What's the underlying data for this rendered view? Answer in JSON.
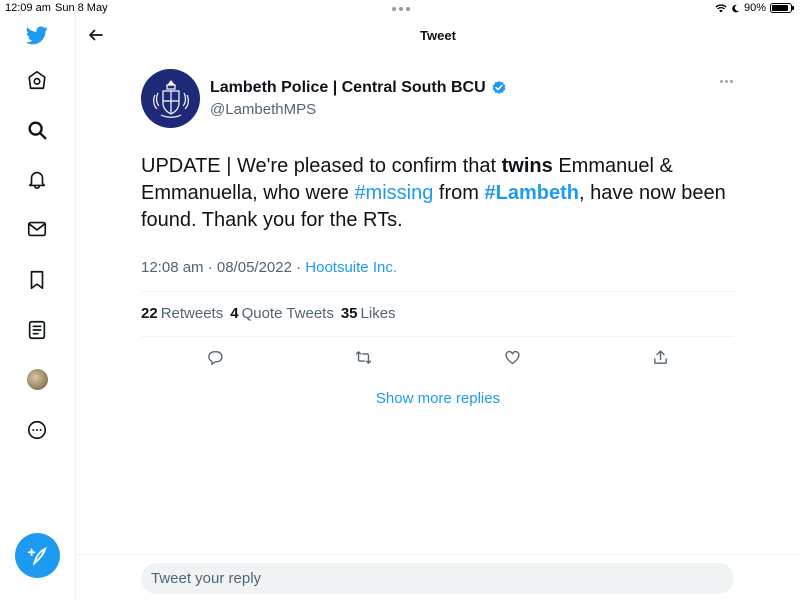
{
  "status_bar": {
    "time": "12:09 am",
    "date": "Sun 8 May",
    "battery": "90%",
    "battery_level": 0.9
  },
  "sidebar": {
    "items": [
      {
        "icon": "twitter-logo-icon"
      },
      {
        "icon": "home-icon"
      },
      {
        "icon": "search-icon"
      },
      {
        "icon": "notifications-icon"
      },
      {
        "icon": "messages-icon"
      },
      {
        "icon": "bookmarks-icon"
      },
      {
        "icon": "lists-icon"
      },
      {
        "icon": "profile-avatar"
      },
      {
        "icon": "more-icon"
      }
    ],
    "compose_icon": "compose-tweet-icon",
    "accent": "#1d9bf0"
  },
  "header": {
    "title": "Tweet"
  },
  "tweet": {
    "author_name": "Lambeth Police | Central South BCU",
    "handle": "@LambethMPS",
    "verified": true,
    "text_parts": {
      "p1": "UPDATE | We're pleased to confirm that ",
      "p2": "twins",
      "p3": " Emmanuel & Emmanuella, who were ",
      "p4": "#missing",
      "p5": " from ",
      "p6": "#Lambeth",
      "p7": ", have now been found. Thank you for the RTs."
    },
    "timestamp": "12:08 am · 08/05/2022 · ",
    "source": "Hootsuite Inc.",
    "stats": {
      "retweets_count": "22",
      "retweets_label": "Retweets",
      "quote_count": "4",
      "quote_label": "Quote Tweets",
      "likes_count": "35",
      "likes_label": "Likes"
    },
    "actions": [
      "reply-icon",
      "retweet-icon",
      "like-icon",
      "share-icon"
    ]
  },
  "show_more_replies": "Show more replies",
  "reply": {
    "placeholder": "Tweet your reply"
  }
}
